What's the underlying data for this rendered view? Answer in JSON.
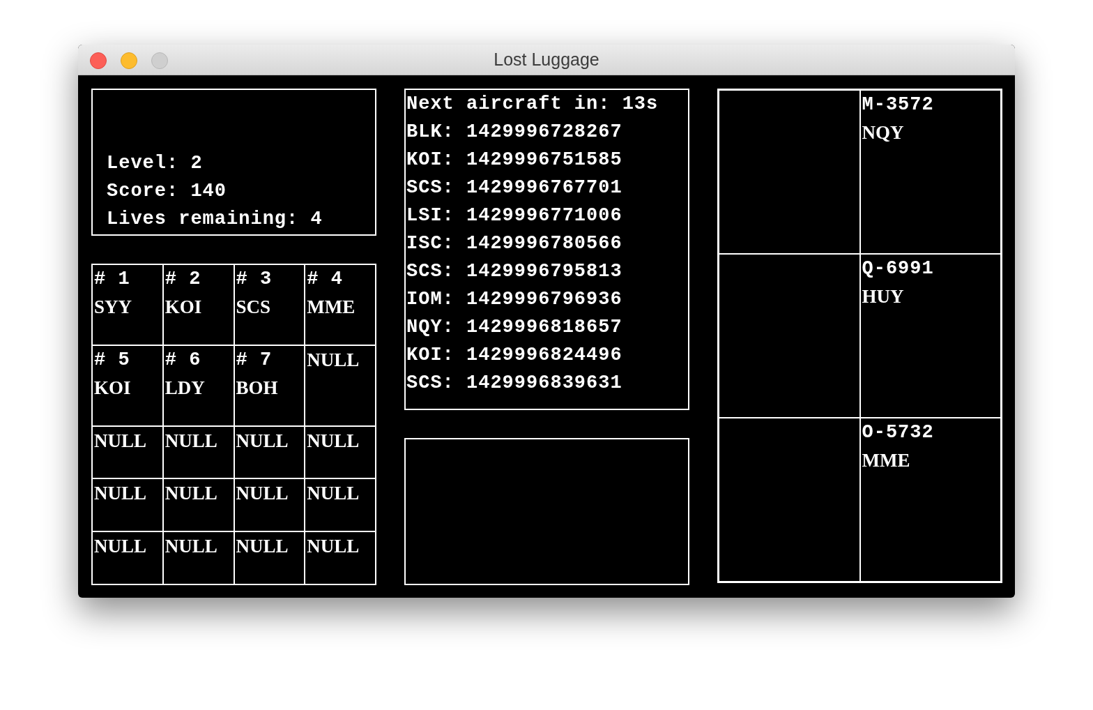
{
  "window": {
    "title": "Lost Luggage"
  },
  "status": {
    "lines": [
      "Level: 2",
      "Score: 140",
      "Lives remaining: 4"
    ]
  },
  "gates": [
    {
      "kind": "occupied",
      "number": "# 1",
      "code": "SYY"
    },
    {
      "kind": "occupied",
      "number": "# 2",
      "code": "KOI"
    },
    {
      "kind": "occupied",
      "number": "# 3",
      "code": "SCS"
    },
    {
      "kind": "occupied",
      "number": "# 4",
      "code": "MME"
    },
    {
      "kind": "occupied",
      "number": "# 5",
      "code": "KOI"
    },
    {
      "kind": "occupied",
      "number": "# 6",
      "code": "LDY"
    },
    {
      "kind": "occupied",
      "number": "# 7",
      "code": "BOH"
    },
    {
      "kind": "empty",
      "code": "NULL"
    },
    {
      "kind": "empty",
      "code": "NULL"
    },
    {
      "kind": "empty",
      "code": "NULL"
    },
    {
      "kind": "empty",
      "code": "NULL"
    },
    {
      "kind": "empty",
      "code": "NULL"
    },
    {
      "kind": "empty",
      "code": "NULL"
    },
    {
      "kind": "empty",
      "code": "NULL"
    },
    {
      "kind": "empty",
      "code": "NULL"
    },
    {
      "kind": "empty",
      "code": "NULL"
    },
    {
      "kind": "empty",
      "code": "NULL"
    },
    {
      "kind": "empty",
      "code": "NULL"
    },
    {
      "kind": "empty",
      "code": "NULL"
    },
    {
      "kind": "empty",
      "code": "NULL"
    }
  ],
  "schedule": {
    "header": "Next aircraft in: 13s",
    "rows": [
      "BLK: 1429996728267",
      "KOI: 1429996751585",
      "SCS: 1429996767701",
      "LSI: 1429996771006",
      "ISC: 1429996780566",
      "SCS: 1429996795813",
      "IOM: 1429996796936",
      "NQY: 1429996818657",
      "KOI: 1429996824496",
      "SCS: 1429996839631"
    ]
  },
  "aircraft": [
    {
      "id": "M-3572",
      "code": "NQY"
    },
    {
      "id": "Q-6991",
      "code": "HUY"
    },
    {
      "id": "O-5732",
      "code": "MME"
    }
  ]
}
